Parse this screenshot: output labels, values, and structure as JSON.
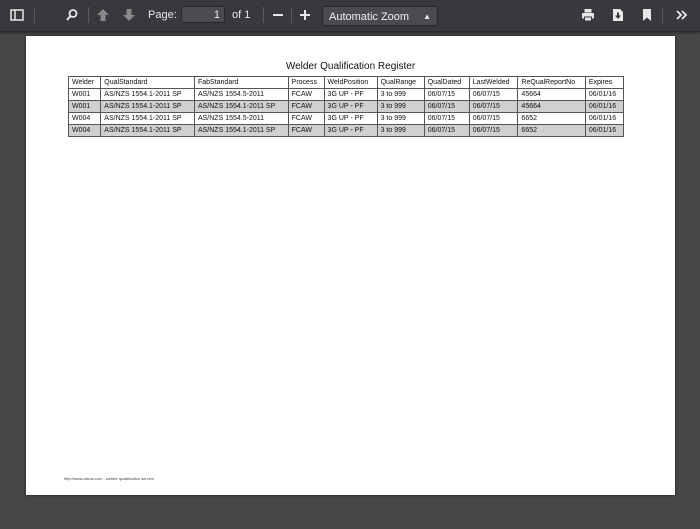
{
  "toolbar": {
    "page_label": "Page:",
    "page_value": "1",
    "page_of": "of 1",
    "zoom_value": "Automatic Zoom",
    "icons": {
      "sidebar": "sidebar-toggle-icon",
      "search": "search-icon",
      "prev": "arrow-up-icon",
      "next": "arrow-down-icon",
      "zoom_out": "minus-icon",
      "zoom_in": "plus-icon",
      "print": "print-icon",
      "download": "download-icon",
      "bookmark": "bookmark-icon",
      "tools": "double-chevron-right-icon"
    }
  },
  "document": {
    "title": "Welder Qualification Register",
    "columns": [
      "Welder",
      "QualStandard",
      "FabStandard",
      "Process",
      "WeldPosition",
      "QualRange",
      "QualDated",
      "LastWelded",
      "ReQualReportNo",
      "Expires"
    ],
    "rows": [
      [
        "W001",
        "AS/NZS 1554.1-2011 SP",
        "AS/NZS 1554.5-2011",
        "FCAW",
        "3G UP - PF",
        "3 to 999",
        "06/07/15",
        "06/07/15",
        "45664",
        "06/01/16"
      ],
      [
        "W001",
        "AS/NZS 1554.1-2011 SP",
        "AS/NZS 1554.1-2011 SP",
        "FCAW",
        "3G UP - PF",
        "3 to 999",
        "06/07/15",
        "06/07/15",
        "45664",
        "06/01/16"
      ],
      [
        "W004",
        "AS/NZS 1554.1-2011 SP",
        "AS/NZS 1554.5-2011",
        "FCAW",
        "3G UP - PF",
        "3 to 999",
        "06/07/15",
        "06/07/15",
        "6652",
        "06/01/16"
      ],
      [
        "W004",
        "AS/NZS 1554.1-2011 SP",
        "AS/NZS 1554.1-2011 SP",
        "FCAW",
        "3G UP - PF",
        "3 to 999",
        "06/07/15",
        "06/07/15",
        "6652",
        "06/01/16"
      ]
    ],
    "footer": "http://www.vlsms.com - welder qualification service"
  },
  "colors": {
    "toolbar_bg": "#38383d",
    "viewer_bg": "#474747",
    "row_alt": "#d0d0d0"
  }
}
